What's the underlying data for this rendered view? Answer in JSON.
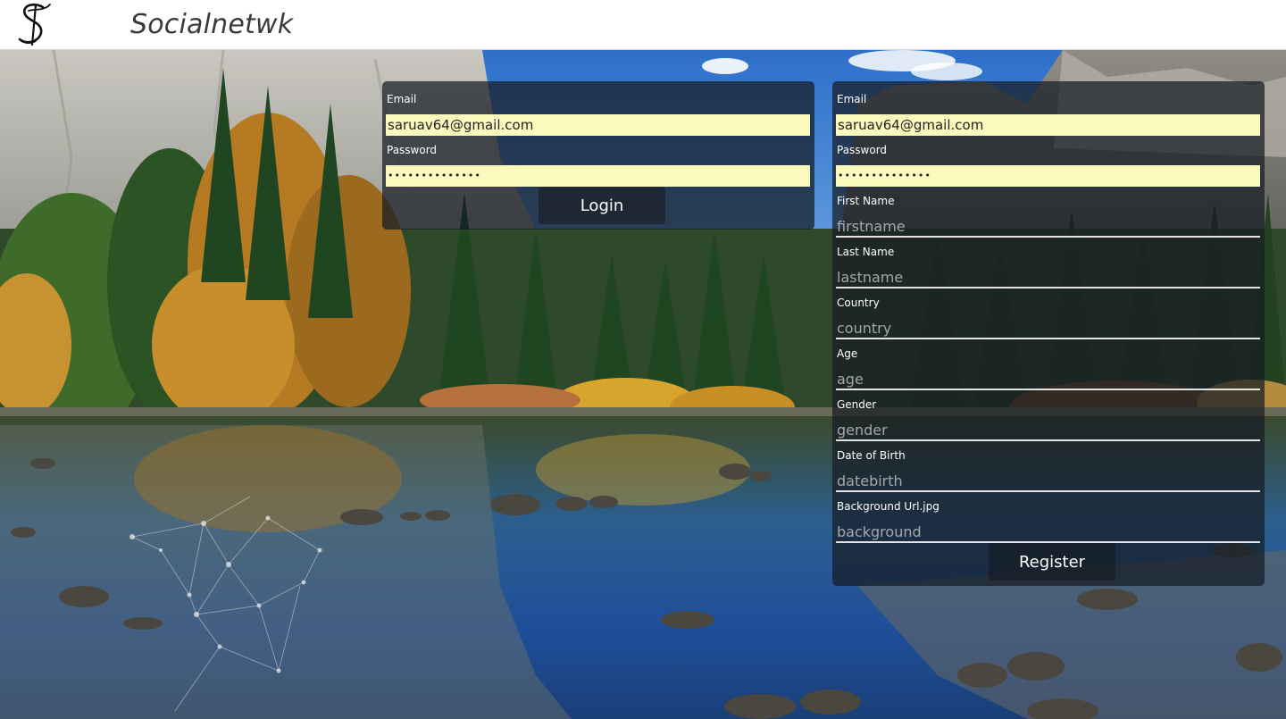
{
  "header": {
    "logo_icon": "cursive-s-logo-icon",
    "brand": "Socialnetwk"
  },
  "login": {
    "email_label": "Email",
    "email_value": "saruav64@gmail.com",
    "password_label": "Password",
    "password_value": "••••••••••••••",
    "button_label": "Login"
  },
  "register": {
    "email_label": "Email",
    "email_value": "saruav64@gmail.com",
    "password_label": "Password",
    "password_value": "••••••••••••••",
    "fields": [
      {
        "label": "First Name",
        "placeholder": "firstname"
      },
      {
        "label": "Last Name",
        "placeholder": "lastname"
      },
      {
        "label": "Country",
        "placeholder": "country"
      },
      {
        "label": "Age",
        "placeholder": "age"
      },
      {
        "label": "Gender",
        "placeholder": "gender"
      },
      {
        "label": "Date of Birth",
        "placeholder": "datebirth"
      },
      {
        "label": "Background Url.jpg",
        "placeholder": "background"
      }
    ],
    "button_label": "Register"
  },
  "colors": {
    "autofill": "#fcf9bd",
    "panel": "#161c24",
    "header_bg": "#ffffff"
  }
}
